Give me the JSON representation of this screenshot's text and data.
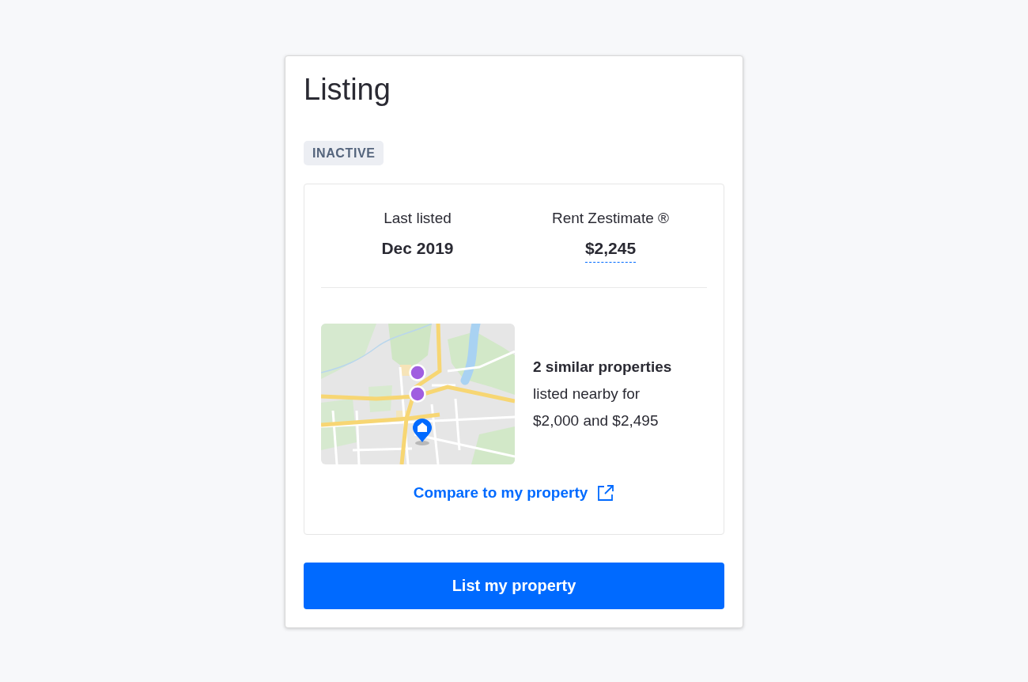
{
  "card": {
    "title": "Listing",
    "status_badge": "INACTIVE",
    "summary": {
      "stats": [
        {
          "label": "Last listed",
          "value": "Dec 2019",
          "kind": "plain"
        },
        {
          "label": "Rent Zestimate ®",
          "value": "$2,245",
          "kind": "tooltip"
        }
      ],
      "similar": {
        "headline": "2 similar properties",
        "description": "listed nearby for $2,000 and $2,495"
      },
      "link": "Compare to my property"
    },
    "button": "List my property"
  }
}
